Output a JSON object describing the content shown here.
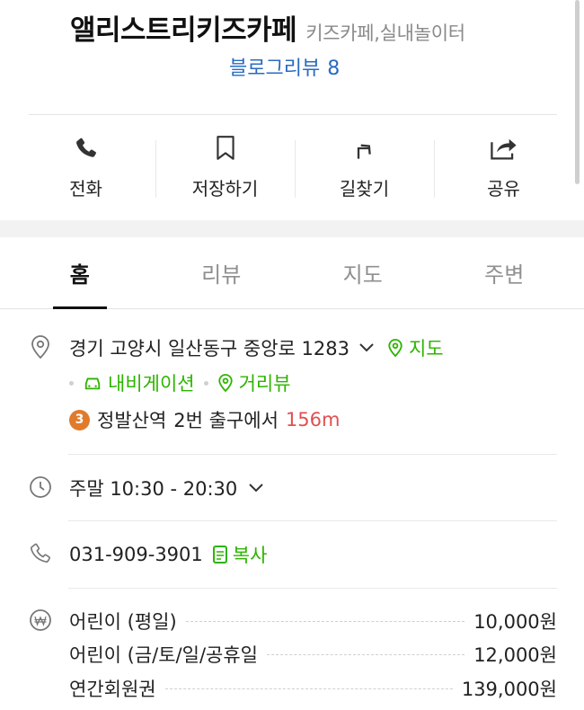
{
  "place": {
    "name": "앨리스트리키즈카페",
    "category": "키즈카페,실내놀이터",
    "blog_review_label": "블로그리뷰",
    "blog_review_count": "8"
  },
  "actions": [
    {
      "label": "전화",
      "icon": "phone-icon"
    },
    {
      "label": "저장하기",
      "icon": "bookmark-icon"
    },
    {
      "label": "길찾기",
      "icon": "directions-icon"
    },
    {
      "label": "공유",
      "icon": "share-icon"
    }
  ],
  "tabs": [
    {
      "label": "홈",
      "active": true
    },
    {
      "label": "리뷰",
      "active": false
    },
    {
      "label": "지도",
      "active": false
    },
    {
      "label": "주변",
      "active": false
    }
  ],
  "address": {
    "text": "경기 고양시 일산동구 중앙로 1283",
    "map_link": "지도",
    "navigation_link": "내비게이션",
    "street_view_link": "거리뷰",
    "subway": {
      "line": "3",
      "station": "정발산역",
      "exit": "2번 출구에서",
      "distance": "156m"
    }
  },
  "hours": {
    "text": "주말 10:30 - 20:30"
  },
  "phone": {
    "number": "031-909-3901",
    "copy_label": "복사"
  },
  "prices": [
    {
      "label": "어린이 (평일)",
      "value": "10,000원"
    },
    {
      "label": "어린이 (금/토/일/공휴일",
      "value": "12,000원"
    },
    {
      "label": "연간회원권",
      "value": "139,000원"
    }
  ],
  "colors": {
    "accent_green": "#2db400",
    "link_blue": "#2a6bc0",
    "distance_red": "#e05050",
    "subway_line3": "#e17b2c"
  }
}
